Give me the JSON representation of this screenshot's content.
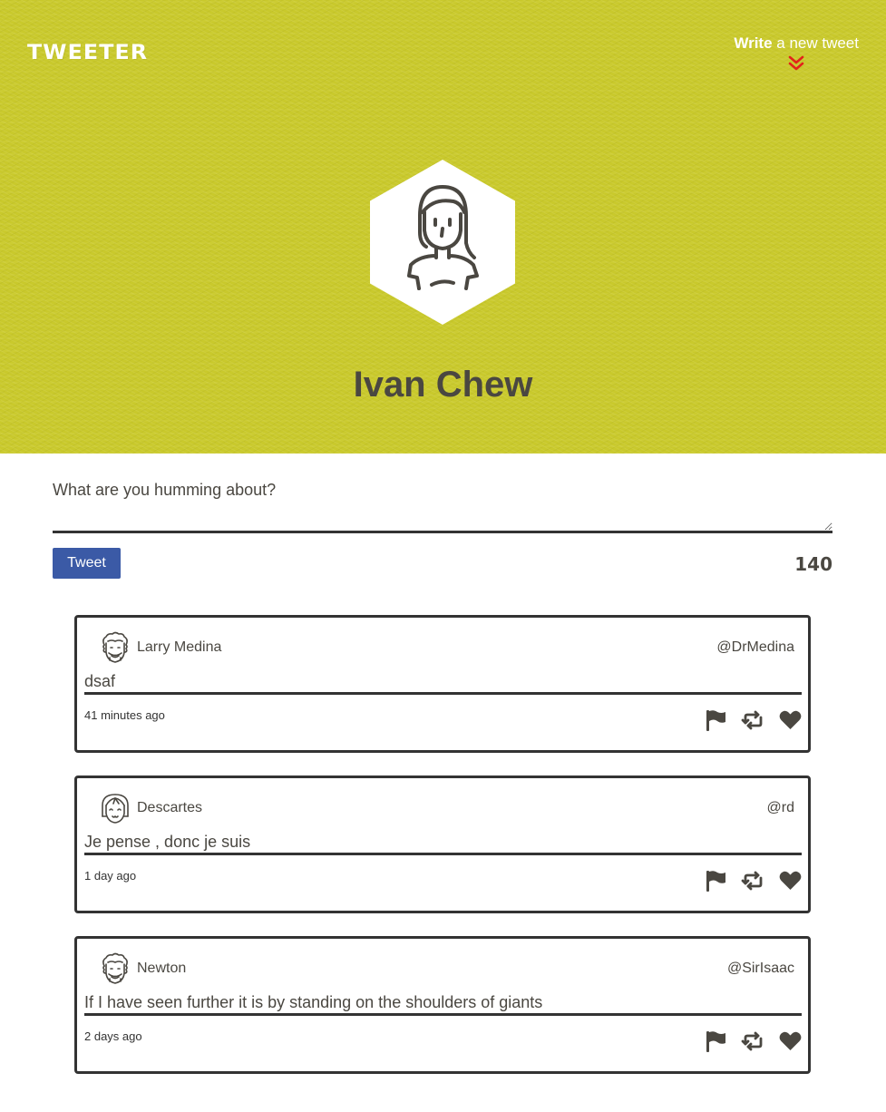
{
  "header": {
    "logo": "TWEETER",
    "write_link": {
      "bold": "Write",
      "rest": " a new tweet"
    },
    "profile_name": "Ivan Chew",
    "background_color": "#c9c92c",
    "chevron_color": "#e2231a"
  },
  "composer": {
    "placeholder": "What are you humming about?",
    "value": "",
    "button_label": "Tweet",
    "char_count": "140",
    "button_color": "#3b5aa6"
  },
  "tweets": [
    {
      "name": "Larry Medina",
      "handle": "@DrMedina",
      "content": "dsaf",
      "time": "41 minutes ago",
      "avatar": "curly-hair-man-icon"
    },
    {
      "name": "Descartes",
      "handle": "@rd",
      "content": "Je pense , donc je suis",
      "time": "1 day ago",
      "avatar": "bob-hair-woman-icon"
    },
    {
      "name": "Newton",
      "handle": "@SirIsaac",
      "content": "If I have seen further it is by standing on the shoulders of giants",
      "time": "2 days ago",
      "avatar": "curly-hair-man-icon"
    }
  ],
  "actions": [
    "flag-icon",
    "retweet-icon",
    "heart-icon"
  ]
}
